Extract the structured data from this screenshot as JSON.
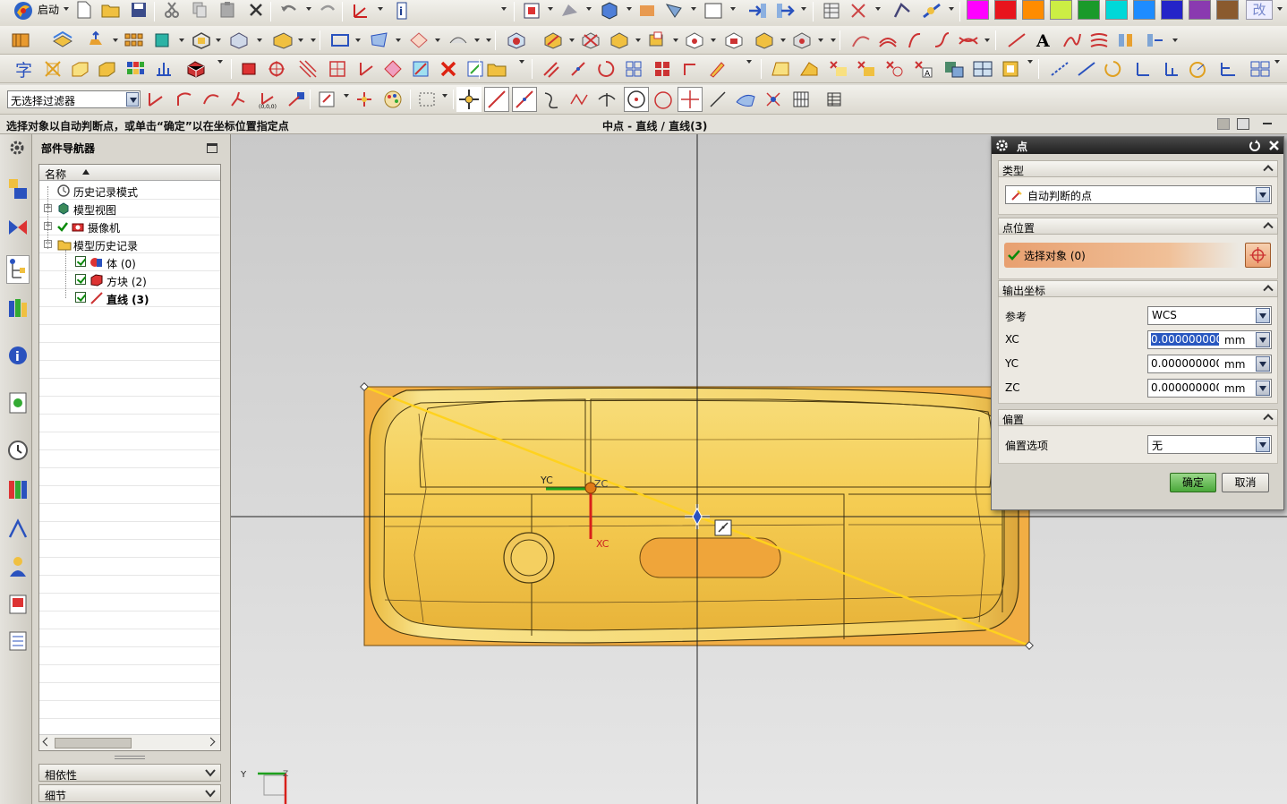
{
  "toolbar": {
    "start_label": "启动",
    "filter_value": "无选择过滤器",
    "swatches": [
      "#ff00ff",
      "#e8141c",
      "#ff8c00",
      "#ccee44",
      "#1a9a2a",
      "#00d8d8",
      "#1e8cff",
      "#2424c8",
      "#8a3ab0",
      "#8a5a2e"
    ],
    "swatch_text": "改"
  },
  "status": {
    "prompt": "选择对象以自动判断点，或单击“确定”以在坐标位置指定点",
    "selection": "中点 - 直线 / 直线(3)"
  },
  "navigator": {
    "title": "部件导航器",
    "column_name": "名称",
    "items": [
      {
        "label": "历史记录模式"
      },
      {
        "label": "模型视图"
      },
      {
        "label": "摄像机"
      },
      {
        "label": "模型历史记录"
      },
      {
        "label": "体 (0)"
      },
      {
        "label": "方块 (2)"
      },
      {
        "label": "直线 (3)"
      }
    ],
    "panels": [
      "相依性",
      "细节"
    ]
  },
  "viewport": {
    "axis_yc": "YC",
    "axis_zc": "ZC",
    "axis_xc": "XC",
    "triad_y": "Y",
    "triad_z": "Z"
  },
  "dialog": {
    "title": "点",
    "sections": {
      "type": "类型",
      "point_location": "点位置",
      "output_coords": "输出坐标",
      "offset": "偏置"
    },
    "type_value": "自动判断的点",
    "select_object": "选择对象 (0)",
    "reference_label": "参考",
    "reference_value": "WCS",
    "coords": [
      {
        "label": "XC",
        "value": "0.000000000",
        "unit": "mm"
      },
      {
        "label": "YC",
        "value": "0.000000000",
        "unit": "mm"
      },
      {
        "label": "ZC",
        "value": "0.000000000",
        "unit": "mm"
      }
    ],
    "offset_label": "偏置选项",
    "offset_value": "无",
    "ok": "确定",
    "cancel": "取消"
  }
}
